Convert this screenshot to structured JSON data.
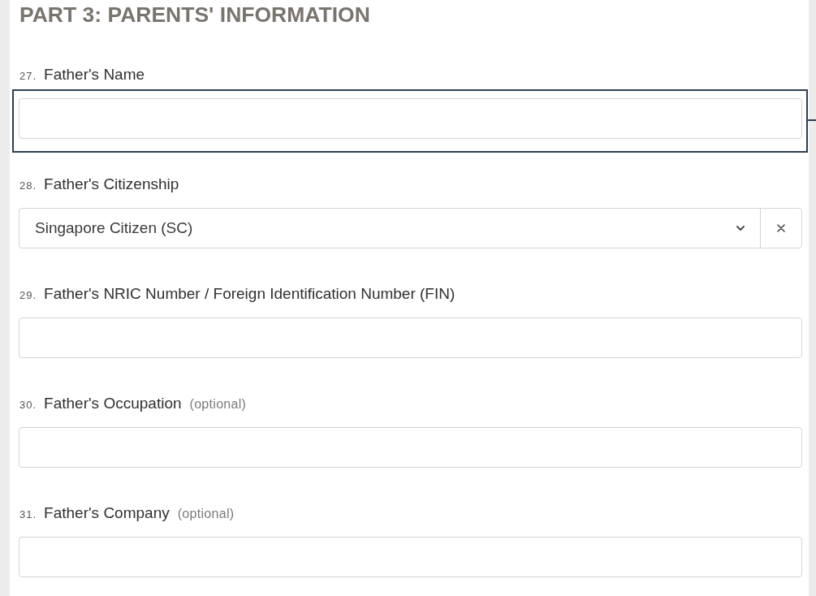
{
  "section_title": "PART 3: PARENTS' INFORMATION",
  "fields": [
    {
      "kind": "text",
      "number": "27.",
      "label": "Father's Name",
      "highlighted": true
    },
    {
      "kind": "select",
      "number": "28.",
      "label": "Father's Citizenship",
      "value": "Singapore Citizen (SC)",
      "highlighted": false
    },
    {
      "kind": "text",
      "number": "29.",
      "label": "Father's NRIC Number / Foreign Identification Number (FIN)",
      "highlighted": false
    },
    {
      "kind": "text",
      "number": "30.",
      "label": "Father's Occupation",
      "optional": "(optional)",
      "highlighted": false
    },
    {
      "kind": "text",
      "number": "31.",
      "label": "Father's Company",
      "optional": "(optional)",
      "highlighted": false
    }
  ]
}
